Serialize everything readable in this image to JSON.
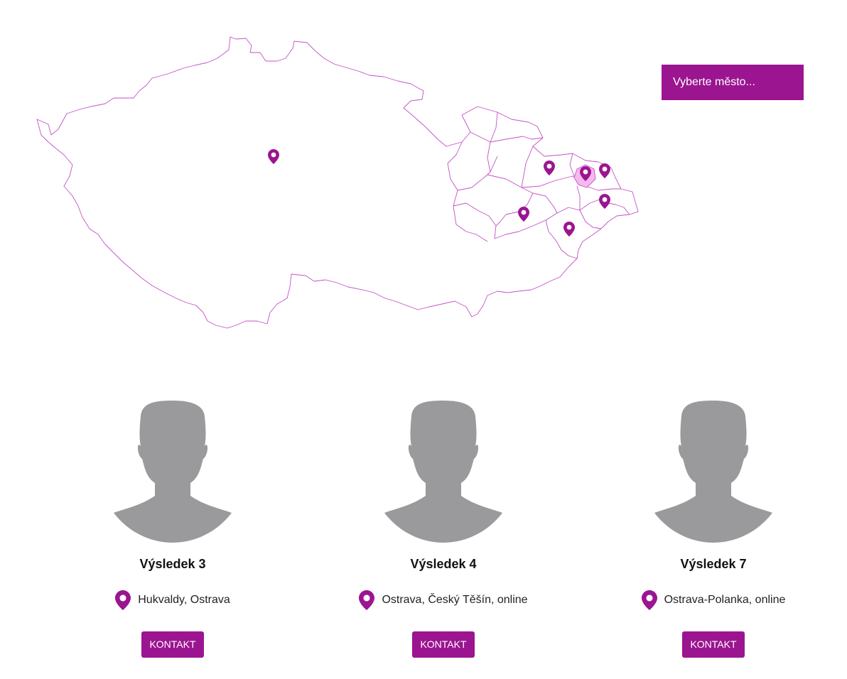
{
  "city_select": {
    "placeholder": "Vyberte město..."
  },
  "colors": {
    "accent": "#9b1590",
    "avatar": "#9a9a9c",
    "highlight_region": "#f6b9ef"
  },
  "map": {
    "country_name": "Česká republika",
    "pins": [
      "pin-central-bohemia",
      "pin-moravia-north",
      "pin-ostrava",
      "pin-frydek",
      "pin-olomouc-south",
      "pin-zlin",
      "pin-moravia-east"
    ]
  },
  "results": [
    {
      "title": "Výsledek 3",
      "location": "Hukvaldy, Ostrava",
      "button": "KONTAKT"
    },
    {
      "title": "Výsledek 4",
      "location": "Ostrava, Český Těšín, online",
      "button": "KONTAKT"
    },
    {
      "title": "Výsledek 7",
      "location": "Ostrava-Polanka, online",
      "button": "KONTAKT"
    }
  ]
}
